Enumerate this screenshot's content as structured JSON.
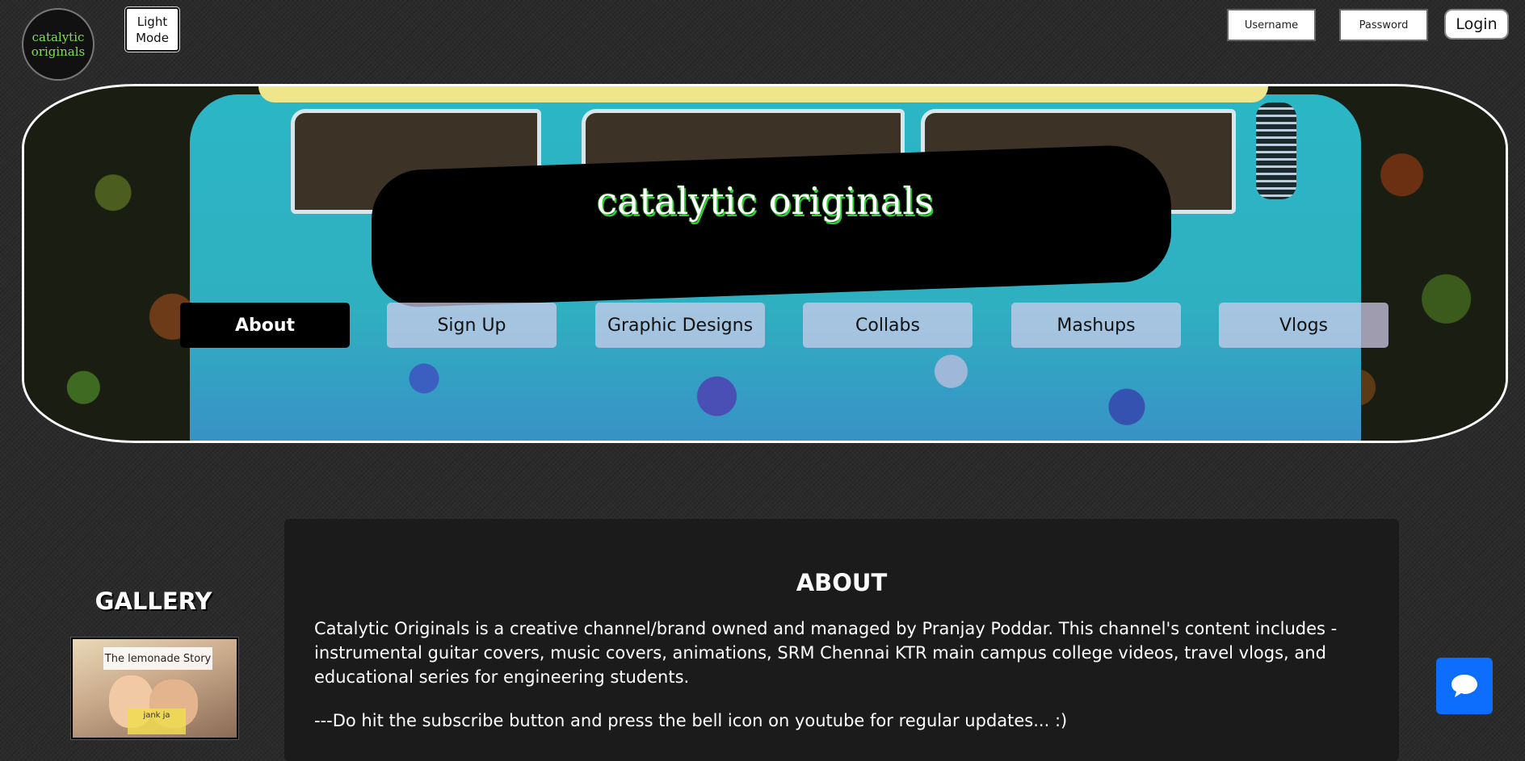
{
  "header": {
    "logo_text": "catalytic originals",
    "mode_button": "Light Mode",
    "username_placeholder": "Username",
    "password_placeholder": "Password",
    "login_label": "Login"
  },
  "hero": {
    "title": "catalytic originals"
  },
  "nav": {
    "items": [
      {
        "label": "About",
        "active": true
      },
      {
        "label": "Sign Up",
        "active": false
      },
      {
        "label": "Graphic Designs",
        "active": false
      },
      {
        "label": "Collabs",
        "active": false
      },
      {
        "label": "Mashups",
        "active": false
      },
      {
        "label": "Vlogs",
        "active": false
      }
    ]
  },
  "gallery": {
    "title": "GALLERY",
    "thumb_caption": "The lemonade Story",
    "thumb_subtitle": "jank ja"
  },
  "about": {
    "title": "ABOUT",
    "paragraph1": "Catalytic Originals is a creative channel/brand owned and managed by Pranjay Poddar. This channel's content includes - instrumental guitar covers, music covers, animations, SRM Chennai KTR main campus college videos, travel vlogs, and educational series for engineering students.",
    "paragraph2": "---Do hit the subscribe button and press the bell icon on youtube for regular updates... :)"
  },
  "colors": {
    "accent_green": "#30d030",
    "chat_blue": "#0d6efd",
    "background": "#2b2b2b"
  },
  "icons": {
    "chat": "chat-bubble-icon"
  }
}
